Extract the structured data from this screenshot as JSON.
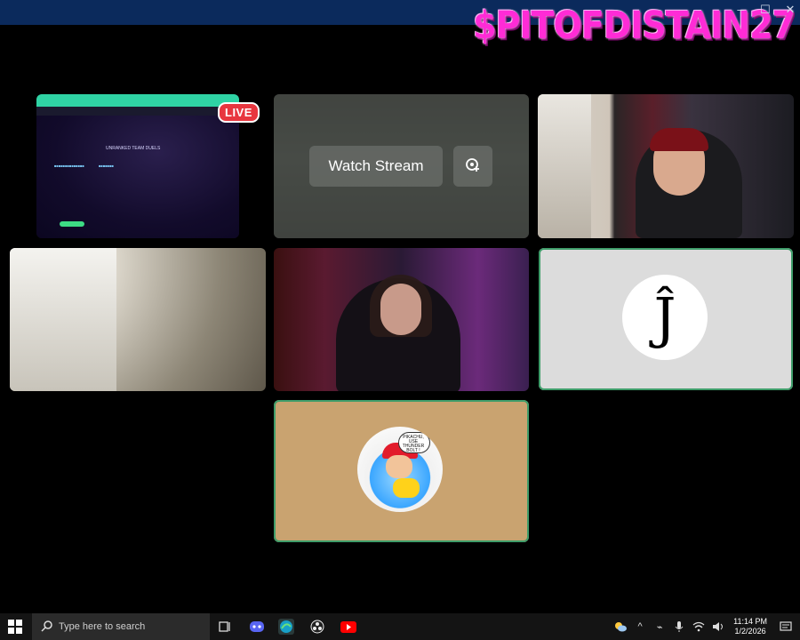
{
  "window": {
    "controls": [
      "minimize-icon",
      "maximize-icon",
      "close-icon"
    ],
    "brand_text": "$PITOFDISTAIN27"
  },
  "tiles": {
    "screen_share": {
      "live_label": "LIVE",
      "page_title": "UNRANKED TEAM DUELS"
    },
    "watch": {
      "watch_label": "Watch Stream",
      "popout_icon": "popout-icon"
    },
    "avatar_j": {
      "letter": "Ĵ"
    },
    "avatar_pika": {
      "speech": "PIKACHU, USE THUNDER BOLT !"
    }
  },
  "taskbar": {
    "search_placeholder": "Type here to search",
    "time": "11:14 PM",
    "date": "1/2/2026",
    "apps": [
      "task-view-icon",
      "discord-icon",
      "edge-icon",
      "obs-icon",
      "youtube-icon"
    ],
    "tray": [
      "weather-icon",
      "chevron-up-icon",
      "network-icon",
      "mic-icon",
      "wifi-icon",
      "volume-icon",
      "notifications-icon"
    ]
  },
  "colors": {
    "accent_live": "#e8363f",
    "speaking_border": "#3f9d6a",
    "brand": "#ff2bd6",
    "titlebar": "#0b2a5c",
    "taskbar": "#141414"
  }
}
